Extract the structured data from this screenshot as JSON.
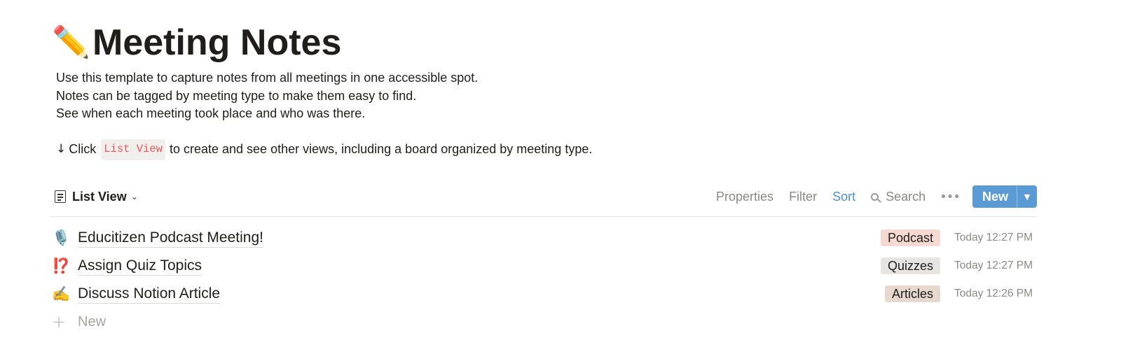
{
  "page": {
    "title_emoji": "✏️",
    "title": "Meeting Notes",
    "description_lines": [
      "Use this template to capture notes from all meetings in one accessible spot.",
      "Notes can be tagged by meeting type to make them easy to find.",
      "See when each meeting took place and who was there."
    ],
    "hint": {
      "arrow": "↓",
      "before": "Click",
      "code": "List View",
      "after": "to create and see other views, including a board organized by meeting type."
    }
  },
  "toolbar": {
    "view_label": "List View",
    "view_icon": "list-view-icon",
    "chevron": "⌄",
    "properties": "Properties",
    "filter": "Filter",
    "sort": "Sort",
    "search": "Search",
    "more": "•••",
    "new_label": "New",
    "new_caret": "⌄",
    "colors": {
      "sort_active": "#4a90d9",
      "new_button": "#5b9bd5"
    }
  },
  "rows": [
    {
      "emoji": "🎙️",
      "title": "Educitizen Podcast Meeting!",
      "tag": "Podcast",
      "tag_color": "#f6d9d3",
      "time": "Today 12:27 PM"
    },
    {
      "emoji": "⁉️",
      "title": "Assign Quiz Topics",
      "tag": "Quizzes",
      "tag_color": "#e6e5e3",
      "time": "Today 12:27 PM"
    },
    {
      "emoji": "✍️",
      "title": "Discuss Notion Article",
      "tag": "Articles",
      "tag_color": "#e6d7cf",
      "time": "Today 12:26 PM"
    }
  ],
  "new_row": {
    "plus": "+",
    "label": "New"
  }
}
